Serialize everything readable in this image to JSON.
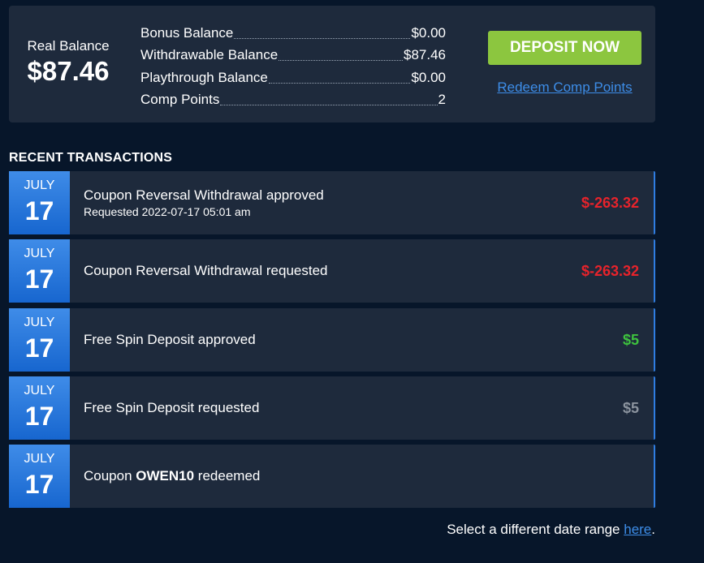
{
  "balance": {
    "real_label": "Real Balance",
    "real_value": "$87.46",
    "rows": [
      {
        "label": "Bonus Balance",
        "value": "$0.00"
      },
      {
        "label": "Withdrawable Balance",
        "value": "$87.46"
      },
      {
        "label": "Playthrough Balance",
        "value": "$0.00"
      },
      {
        "label": "Comp Points",
        "value": "2"
      }
    ],
    "deposit_button": "DEPOSIT NOW",
    "redeem_link": "Redeem Comp Points"
  },
  "transactions": {
    "title": "RECENT TRANSACTIONS",
    "items": [
      {
        "month": "JULY",
        "day": "17",
        "title": "Coupon Reversal Withdrawal approved",
        "sub": "Requested 2022-07-17 05:01 am",
        "amount": "$-263.32"
      },
      {
        "month": "JULY",
        "day": "17",
        "title": "Coupon Reversal Withdrawal requested",
        "amount": "$-263.32"
      },
      {
        "month": "JULY",
        "day": "17",
        "title": "Free Spin Deposit approved",
        "amount": "$5"
      },
      {
        "month": "JULY",
        "day": "17",
        "title": "Free Spin Deposit requested",
        "amount": "$5"
      },
      {
        "month": "JULY",
        "day": "17",
        "title_prefix": "Coupon ",
        "title_code": "OWEN10",
        "title_suffix": " redeemed"
      }
    ]
  },
  "footer": {
    "text": "Select a different date range ",
    "link": "here",
    "end": "."
  },
  "colors": {
    "background": "#07162a",
    "panel": "#1e2a3c",
    "accent_blue": "#2f7de1",
    "deposit_green": "#8cc63f",
    "negative": "#e8232b",
    "positive": "#3ec23e",
    "pending": "#8b939e"
  }
}
